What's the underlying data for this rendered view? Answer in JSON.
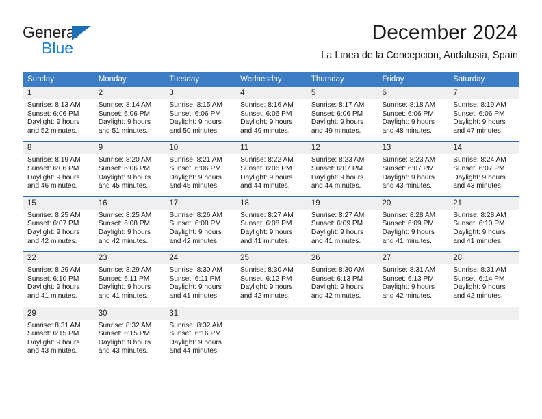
{
  "brand": {
    "name_top": "General",
    "name_bottom": "Blue",
    "triangle_icon": "triangle-icon",
    "color_dark": "#231f20",
    "color_blue": "#1b7fd4"
  },
  "header": {
    "title": "December 2024",
    "location": "La Linea de la Concepcion, Andalusia, Spain"
  },
  "theme": {
    "header_blue": "#3c7dc4",
    "row_divider_blue": "#2b6cb0",
    "daynum_band": "#efefef"
  },
  "weekdays": [
    "Sunday",
    "Monday",
    "Tuesday",
    "Wednesday",
    "Thursday",
    "Friday",
    "Saturday"
  ],
  "weeks": [
    [
      {
        "day": "1",
        "sunrise": "Sunrise: 8:13 AM",
        "sunset": "Sunset: 6:06 PM",
        "daylight1": "Daylight: 9 hours",
        "daylight2": "and 52 minutes."
      },
      {
        "day": "2",
        "sunrise": "Sunrise: 8:14 AM",
        "sunset": "Sunset: 6:06 PM",
        "daylight1": "Daylight: 9 hours",
        "daylight2": "and 51 minutes."
      },
      {
        "day": "3",
        "sunrise": "Sunrise: 8:15 AM",
        "sunset": "Sunset: 6:06 PM",
        "daylight1": "Daylight: 9 hours",
        "daylight2": "and 50 minutes."
      },
      {
        "day": "4",
        "sunrise": "Sunrise: 8:16 AM",
        "sunset": "Sunset: 6:06 PM",
        "daylight1": "Daylight: 9 hours",
        "daylight2": "and 49 minutes."
      },
      {
        "day": "5",
        "sunrise": "Sunrise: 8:17 AM",
        "sunset": "Sunset: 6:06 PM",
        "daylight1": "Daylight: 9 hours",
        "daylight2": "and 49 minutes."
      },
      {
        "day": "6",
        "sunrise": "Sunrise: 8:18 AM",
        "sunset": "Sunset: 6:06 PM",
        "daylight1": "Daylight: 9 hours",
        "daylight2": "and 48 minutes."
      },
      {
        "day": "7",
        "sunrise": "Sunrise: 8:19 AM",
        "sunset": "Sunset: 6:06 PM",
        "daylight1": "Daylight: 9 hours",
        "daylight2": "and 47 minutes."
      }
    ],
    [
      {
        "day": "8",
        "sunrise": "Sunrise: 8:19 AM",
        "sunset": "Sunset: 6:06 PM",
        "daylight1": "Daylight: 9 hours",
        "daylight2": "and 46 minutes."
      },
      {
        "day": "9",
        "sunrise": "Sunrise: 8:20 AM",
        "sunset": "Sunset: 6:06 PM",
        "daylight1": "Daylight: 9 hours",
        "daylight2": "and 45 minutes."
      },
      {
        "day": "10",
        "sunrise": "Sunrise: 8:21 AM",
        "sunset": "Sunset: 6:06 PM",
        "daylight1": "Daylight: 9 hours",
        "daylight2": "and 45 minutes."
      },
      {
        "day": "11",
        "sunrise": "Sunrise: 8:22 AM",
        "sunset": "Sunset: 6:06 PM",
        "daylight1": "Daylight: 9 hours",
        "daylight2": "and 44 minutes."
      },
      {
        "day": "12",
        "sunrise": "Sunrise: 8:23 AM",
        "sunset": "Sunset: 6:07 PM",
        "daylight1": "Daylight: 9 hours",
        "daylight2": "and 44 minutes."
      },
      {
        "day": "13",
        "sunrise": "Sunrise: 8:23 AM",
        "sunset": "Sunset: 6:07 PM",
        "daylight1": "Daylight: 9 hours",
        "daylight2": "and 43 minutes."
      },
      {
        "day": "14",
        "sunrise": "Sunrise: 8:24 AM",
        "sunset": "Sunset: 6:07 PM",
        "daylight1": "Daylight: 9 hours",
        "daylight2": "and 43 minutes."
      }
    ],
    [
      {
        "day": "15",
        "sunrise": "Sunrise: 8:25 AM",
        "sunset": "Sunset: 6:07 PM",
        "daylight1": "Daylight: 9 hours",
        "daylight2": "and 42 minutes."
      },
      {
        "day": "16",
        "sunrise": "Sunrise: 8:25 AM",
        "sunset": "Sunset: 6:08 PM",
        "daylight1": "Daylight: 9 hours",
        "daylight2": "and 42 minutes."
      },
      {
        "day": "17",
        "sunrise": "Sunrise: 8:26 AM",
        "sunset": "Sunset: 6:08 PM",
        "daylight1": "Daylight: 9 hours",
        "daylight2": "and 42 minutes."
      },
      {
        "day": "18",
        "sunrise": "Sunrise: 8:27 AM",
        "sunset": "Sunset: 6:08 PM",
        "daylight1": "Daylight: 9 hours",
        "daylight2": "and 41 minutes."
      },
      {
        "day": "19",
        "sunrise": "Sunrise: 8:27 AM",
        "sunset": "Sunset: 6:09 PM",
        "daylight1": "Daylight: 9 hours",
        "daylight2": "and 41 minutes."
      },
      {
        "day": "20",
        "sunrise": "Sunrise: 8:28 AM",
        "sunset": "Sunset: 6:09 PM",
        "daylight1": "Daylight: 9 hours",
        "daylight2": "and 41 minutes."
      },
      {
        "day": "21",
        "sunrise": "Sunrise: 8:28 AM",
        "sunset": "Sunset: 6:10 PM",
        "daylight1": "Daylight: 9 hours",
        "daylight2": "and 41 minutes."
      }
    ],
    [
      {
        "day": "22",
        "sunrise": "Sunrise: 8:29 AM",
        "sunset": "Sunset: 6:10 PM",
        "daylight1": "Daylight: 9 hours",
        "daylight2": "and 41 minutes."
      },
      {
        "day": "23",
        "sunrise": "Sunrise: 8:29 AM",
        "sunset": "Sunset: 6:11 PM",
        "daylight1": "Daylight: 9 hours",
        "daylight2": "and 41 minutes."
      },
      {
        "day": "24",
        "sunrise": "Sunrise: 8:30 AM",
        "sunset": "Sunset: 6:11 PM",
        "daylight1": "Daylight: 9 hours",
        "daylight2": "and 41 minutes."
      },
      {
        "day": "25",
        "sunrise": "Sunrise: 8:30 AM",
        "sunset": "Sunset: 6:12 PM",
        "daylight1": "Daylight: 9 hours",
        "daylight2": "and 42 minutes."
      },
      {
        "day": "26",
        "sunrise": "Sunrise: 8:30 AM",
        "sunset": "Sunset: 6:13 PM",
        "daylight1": "Daylight: 9 hours",
        "daylight2": "and 42 minutes."
      },
      {
        "day": "27",
        "sunrise": "Sunrise: 8:31 AM",
        "sunset": "Sunset: 6:13 PM",
        "daylight1": "Daylight: 9 hours",
        "daylight2": "and 42 minutes."
      },
      {
        "day": "28",
        "sunrise": "Sunrise: 8:31 AM",
        "sunset": "Sunset: 6:14 PM",
        "daylight1": "Daylight: 9 hours",
        "daylight2": "and 42 minutes."
      }
    ],
    [
      {
        "day": "29",
        "sunrise": "Sunrise: 8:31 AM",
        "sunset": "Sunset: 6:15 PM",
        "daylight1": "Daylight: 9 hours",
        "daylight2": "and 43 minutes."
      },
      {
        "day": "30",
        "sunrise": "Sunrise: 8:32 AM",
        "sunset": "Sunset: 6:15 PM",
        "daylight1": "Daylight: 9 hours",
        "daylight2": "and 43 minutes."
      },
      {
        "day": "31",
        "sunrise": "Sunrise: 8:32 AM",
        "sunset": "Sunset: 6:16 PM",
        "daylight1": "Daylight: 9 hours",
        "daylight2": "and 44 minutes."
      },
      {
        "day": "",
        "sunrise": "",
        "sunset": "",
        "daylight1": "",
        "daylight2": ""
      },
      {
        "day": "",
        "sunrise": "",
        "sunset": "",
        "daylight1": "",
        "daylight2": ""
      },
      {
        "day": "",
        "sunrise": "",
        "sunset": "",
        "daylight1": "",
        "daylight2": ""
      },
      {
        "day": "",
        "sunrise": "",
        "sunset": "",
        "daylight1": "",
        "daylight2": ""
      }
    ]
  ]
}
